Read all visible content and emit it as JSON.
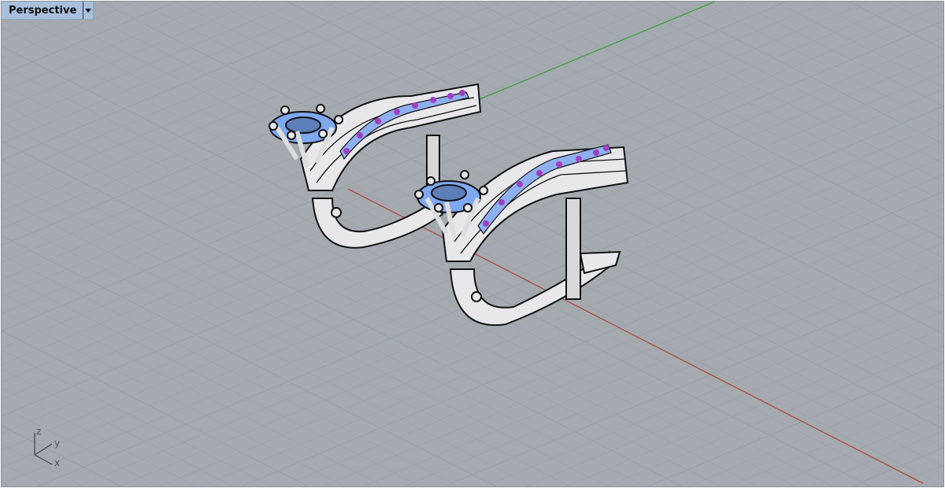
{
  "viewport": {
    "title": "Perspective",
    "menu_icon": "chevron-down-icon"
  },
  "axis_icon": {
    "x": "x",
    "y": "y",
    "z": "z"
  },
  "colors": {
    "background": "#a5aab0",
    "grid": "#98a0a8",
    "x_axis": "#b04a3e",
    "y_axis": "#3aa03a",
    "stone_blue": "#7ea8f0",
    "accent_stone": "#a040c0"
  }
}
